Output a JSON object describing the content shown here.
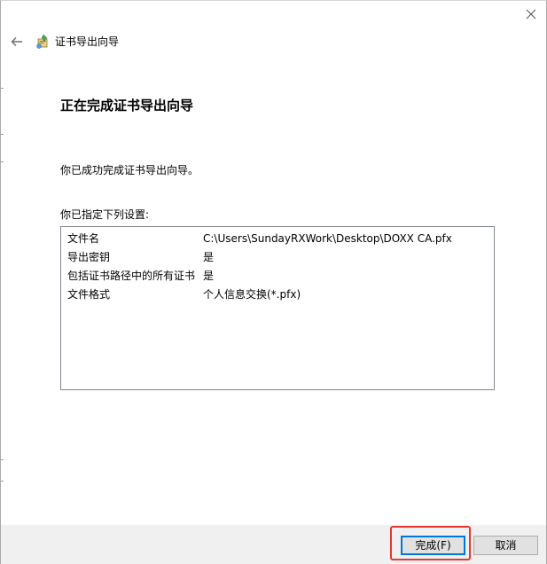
{
  "window": {
    "title": "证书导出向导"
  },
  "content": {
    "heading": "正在完成证书导出向导",
    "success_message": "你已成功完成证书导出向导。",
    "settings_label": "你已指定下列设置:"
  },
  "settings": [
    {
      "key": "文件名",
      "value": "C:\\Users\\SundayRXWork\\Desktop\\DOXX CA.pfx"
    },
    {
      "key": "导出密钥",
      "value": "是"
    },
    {
      "key": "包括证书路径中的所有证书",
      "value": "是"
    },
    {
      "key": "文件格式",
      "value": "个人信息交换(*.pfx)"
    }
  ],
  "footer": {
    "finish_label": "完成(F)",
    "cancel_label": "取消"
  },
  "icons": {
    "close": "close-icon",
    "back": "back-arrow-icon",
    "wizard": "certificate-wizard-icon"
  },
  "colors": {
    "accent": "#0078d7",
    "highlight": "#e53935"
  }
}
